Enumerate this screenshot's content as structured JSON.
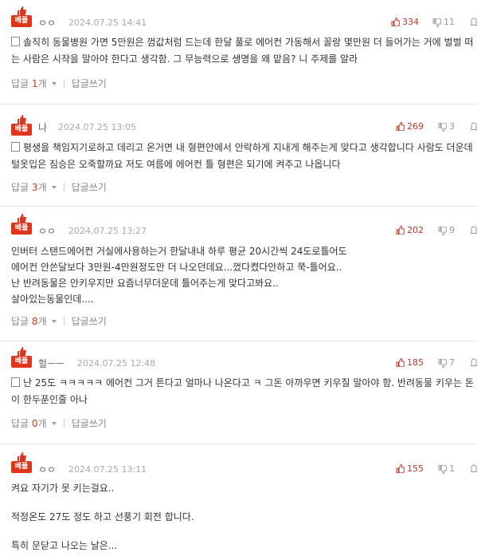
{
  "best_label": "베플",
  "reply_label": "답글",
  "reply_unit": "개",
  "write_reply_label": "답글쓰기",
  "comments": [
    {
      "nick": "ㅇㅇ",
      "date": "2024.07.25 14:41",
      "up": "334",
      "down": "11",
      "text": "솔직히 동물병원 가면 5만원은 껌값처럼 드는데 한달 풀로 에어컨 가동해서 꼴랑 몇만원 더 들어가는 거에 벌벌 떠는 사람은 시작을 말아야 한다고 생각함. 그 무능력으로 생명을 왜 맡음? 니 주제를 알라",
      "replies": "1"
    },
    {
      "nick": "나",
      "date": "2024.07.25 13:05",
      "up": "269",
      "down": "3",
      "text": "평생을 책임지기로하고 데리고 온거면 내 형편안에서 안락하게 지내게 해주는게 맞다고 생각합니다 사람도 더운데 털옷입은 짐승은 오죽할까요 저도 여름에 에어컨 틀 형편은 되기에 켜주고 나옵니다",
      "replies": "3"
    },
    {
      "nick": "ㅇㅇ",
      "date": "2024.07.25 13:27",
      "up": "202",
      "down": "9",
      "text": "인버터 스탠드에어컨 거실에사용하는거 한달내내 하루 평균 20시간씩 24도로틀어도\n에어컨 안쓴달보다 3만원-4만원정도만 더 나오던데요...껐다켰다안하고 쭉-틀어요..\n난 반려동물은 안키우지만 요즘너무더운데 틀어주는게 맞다고봐요..\n살아있는동물인데....",
      "replies": "8"
    },
    {
      "nick": "헐ㅡㅡ",
      "date": "2024.07.25 12:48",
      "up": "185",
      "down": "7",
      "text": "난 25도 ㅋㅋㅋㅋㅋ 에어컨 그거 튼다고 얼마나 나온다고 ㅋ 그돈 아까우면 키우질 말아야 함. 반려동물 키우는 돈이 한두푼인줄 아나",
      "replies": "0"
    },
    {
      "nick": "ㅇㅇ",
      "date": "2024.07.25 13:11",
      "up": "155",
      "down": "1",
      "text": "켜요 자기가 못 키는걸요..\n\n적정온도 27도 정도 하고 선풍기 회전 합니다.\n\n특히 문닫고 나오는 날은...",
      "replies": ""
    }
  ]
}
